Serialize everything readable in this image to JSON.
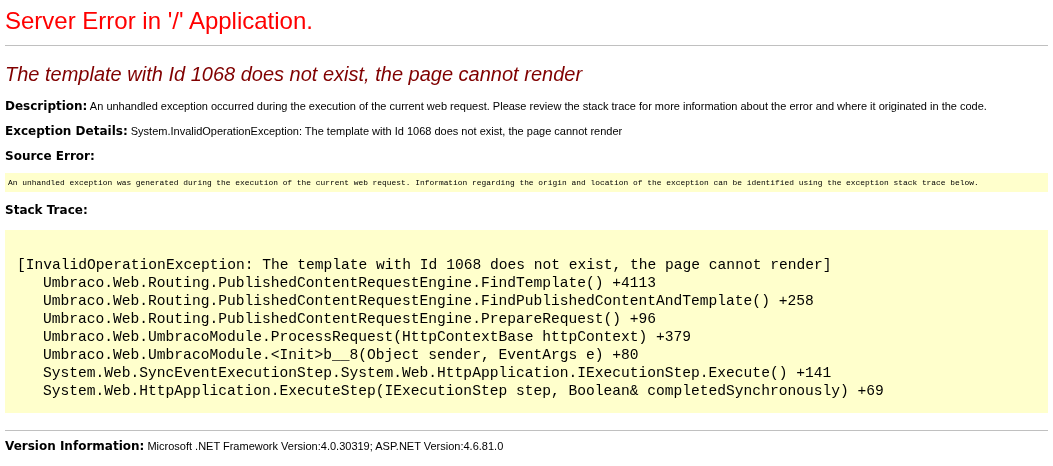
{
  "title": "Server Error in '/' Application.",
  "error_heading": "The template with Id 1068 does not exist, the page cannot render",
  "description": "**Description:** An unhandled exception occurred during the execution of the current web request. Please review the stack trace for more information about the error and where it originated in the code.",
  "exception_details": "**Exception Details:** System.InvalidOperationException: The template with Id 1068 does not exist, the page cannot render",
  "source_error": {
    "heading": "Source Error:",
    "message": "An unhandled exception was generated during the execution of the current web request. Information regarding the origin and location of the exception can be identified using the exception stack trace below."
  },
  "stack_trace": {
    "heading": "Stack Trace:",
    "exception": "[InvalidOperationException: The template with Id 1068 does not exist, the page cannot render]",
    "frames": [
      "Umbraco.Web.Routing.PublishedContentRequestEngine.FindTemplate() +4113",
      "Umbraco.Web.Routing.PublishedContentRequestEngine.FindPublishedContentAndTemplate() +258",
      "Umbraco.Web.Routing.PublishedContentRequestEngine.PrepareRequest() +96",
      "Umbraco.Web.UmbracoModule.ProcessRequest(HttpContextBase httpContext) +379",
      "Umbraco.Web.UmbracoModule.<Init>b__8(Object sender, EventArgs e) +80",
      "System.Web.SyncEventExecutionStep.System.Web.HttpApplication.IExecutionStep.Execute() +141",
      "System.Web.HttpApplication.ExecuteStep(IExecutionStep step, Boolean& completedSynchronously) +69"
    ]
  },
  "version_information": "**Version Information:** Microsoft .NET Framework Version:4.0.30319; ASP.NET Version:4.6.81.0"
}
